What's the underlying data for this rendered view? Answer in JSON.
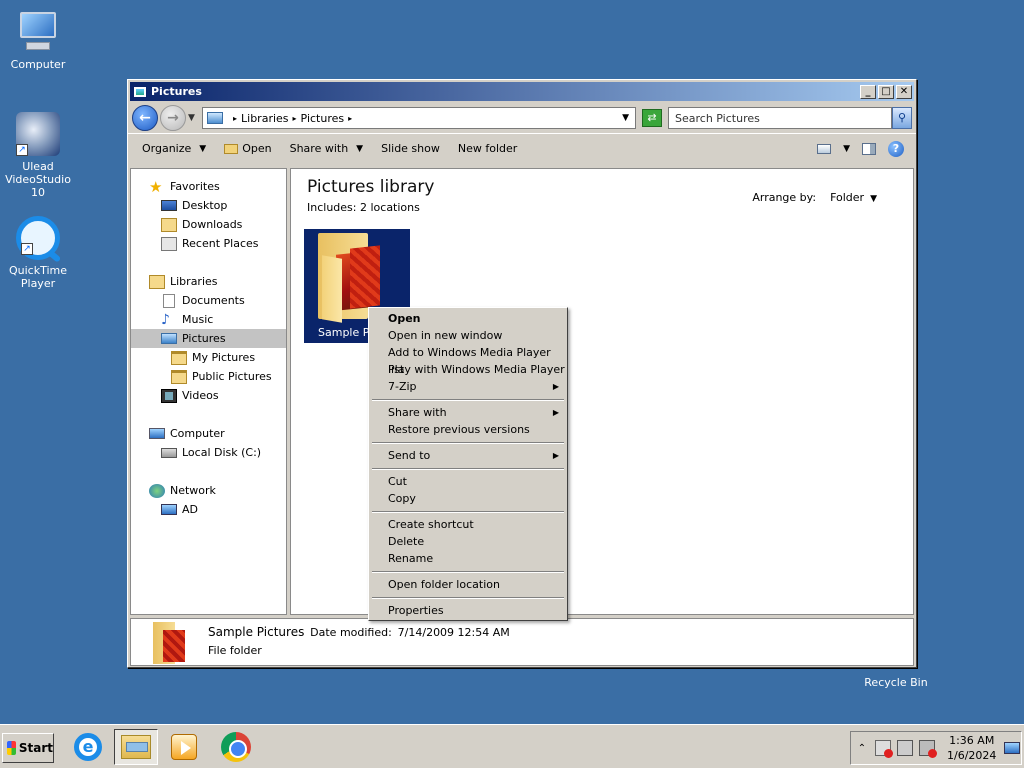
{
  "desktop": {
    "icons": [
      {
        "label": "Computer"
      },
      {
        "label": "Ulead VideoStudio 10"
      },
      {
        "label": "QuickTime Player"
      }
    ],
    "recycle_bin": "Recycle Bin"
  },
  "window": {
    "title": "Pictures",
    "controls": {
      "minimize": "_",
      "maximize": "□",
      "close": "✕"
    },
    "address": {
      "crumbs": [
        "Libraries",
        "Pictures"
      ],
      "search_placeholder": "Search Pictures"
    },
    "toolbar": {
      "organize": "Organize",
      "open": "Open",
      "share_with": "Share with",
      "slide_show": "Slide show",
      "new_folder": "New folder",
      "help": "?"
    },
    "nav": {
      "favorites": "Favorites",
      "desktop": "Desktop",
      "downloads": "Downloads",
      "recent_places": "Recent Places",
      "libraries": "Libraries",
      "documents": "Documents",
      "music": "Music",
      "pictures": "Pictures",
      "my_pictures": "My Pictures",
      "public_pictures": "Public Pictures",
      "videos": "Videos",
      "computer": "Computer",
      "local_disk": "Local Disk (C:)",
      "network": "Network",
      "ad": "AD"
    },
    "content": {
      "title": "Pictures library",
      "includes_label": "Includes:",
      "includes_value": "2 locations",
      "arrange_by_label": "Arrange by:",
      "arrange_by_value": "Folder",
      "folder_name": "Sample Pictures"
    },
    "details": {
      "name": "Sample Pictures",
      "date_label": "Date modified:",
      "date_value": "7/14/2009 12:54 AM",
      "type": "File folder"
    }
  },
  "context_menu": {
    "open": "Open",
    "open_new_window": "Open in new window",
    "add_wmp": "Add to Windows Media Player list",
    "play_wmp": "Play with Windows Media Player",
    "seven_zip": "7-Zip",
    "share_with": "Share with",
    "restore": "Restore previous versions",
    "send_to": "Send to",
    "cut": "Cut",
    "copy": "Copy",
    "create_shortcut": "Create shortcut",
    "delete": "Delete",
    "rename": "Rename",
    "open_location": "Open folder location",
    "properties": "Properties"
  },
  "taskbar": {
    "start": "Start",
    "time": "1:36 AM",
    "date": "1/6/2024"
  }
}
